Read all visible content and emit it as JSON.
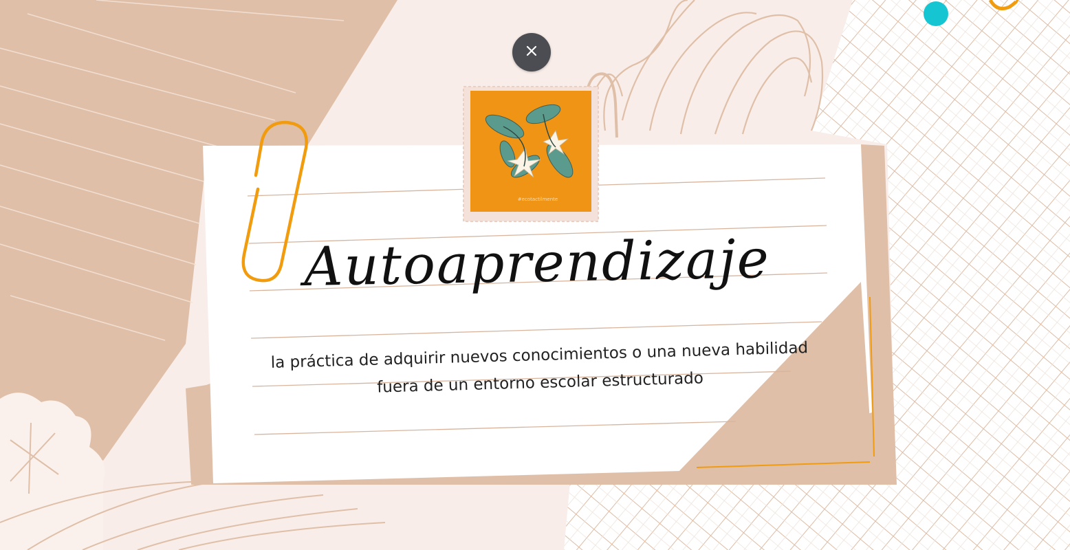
{
  "slide": {
    "title": "Autoaprendizaje",
    "subtitle": "la práctica de adquirir nuevos conocimientos o una nueva habilidad fuera de un entorno escolar estructurado",
    "stamp_caption": "#ecotactilmente"
  },
  "controls": {
    "close_icon": "close-icon",
    "close_label": ""
  },
  "colors": {
    "background": "#f8ede8",
    "tan": "#dfbfa8",
    "card": "#ffffff",
    "accent_orange": "#f19b0e",
    "accent_teal": "#16c5d2",
    "close_button": "#4b4d52",
    "stamp_orange": "#ef9414",
    "leaf_green": "#5b9b8d"
  }
}
